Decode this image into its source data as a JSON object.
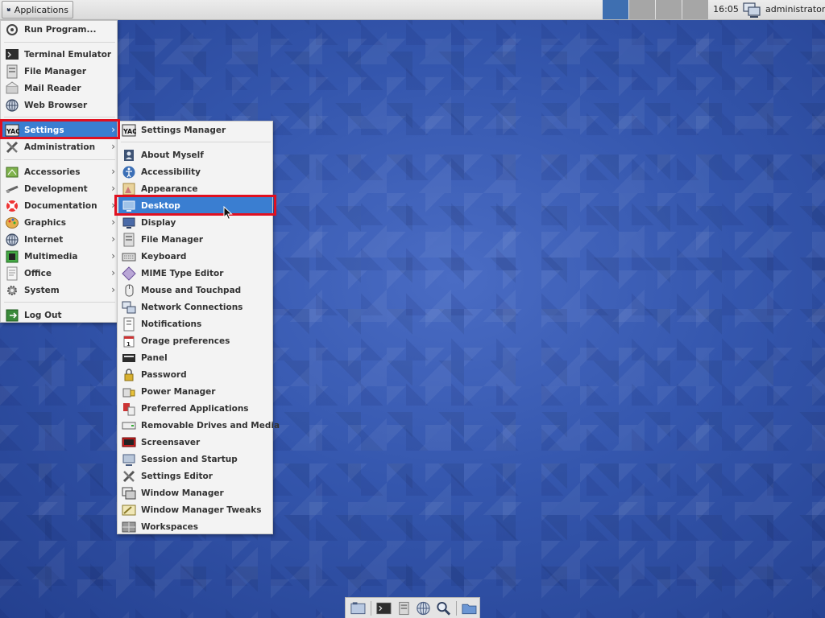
{
  "panel": {
    "applications_label": "Applications",
    "clock": "16:05",
    "user": "administrator",
    "workspace_count": 4,
    "active_workspace": 1
  },
  "main_menu": {
    "items": [
      {
        "label": "Run Program...",
        "icon": "run-icon",
        "submenu": false
      },
      {
        "label": "Terminal Emulator",
        "icon": "terminal-icon",
        "submenu": false
      },
      {
        "label": "File Manager",
        "icon": "file-manager-icon",
        "submenu": false
      },
      {
        "label": "Mail Reader",
        "icon": "mail-icon",
        "submenu": false
      },
      {
        "label": "Web Browser",
        "icon": "globe-icon",
        "submenu": false
      },
      {
        "label": "Settings",
        "icon": "settings-icon",
        "submenu": true,
        "highlighted": true
      },
      {
        "label": "Administration",
        "icon": "tools-icon",
        "submenu": true
      },
      {
        "label": "Accessories",
        "icon": "accessories-icon",
        "submenu": true
      },
      {
        "label": "Development",
        "icon": "development-icon",
        "submenu": true
      },
      {
        "label": "Documentation",
        "icon": "lifebuoy-icon",
        "submenu": true
      },
      {
        "label": "Graphics",
        "icon": "palette-icon",
        "submenu": true
      },
      {
        "label": "Internet",
        "icon": "globe-icon",
        "submenu": true
      },
      {
        "label": "Multimedia",
        "icon": "multimedia-icon",
        "submenu": true
      },
      {
        "label": "Office",
        "icon": "office-icon",
        "submenu": true
      },
      {
        "label": "System",
        "icon": "gear-icon",
        "submenu": true
      },
      {
        "label": "Log Out",
        "icon": "logout-icon",
        "submenu": false
      }
    ]
  },
  "settings_menu": {
    "items": [
      {
        "label": "Settings Manager",
        "icon": "settings-manager-icon"
      },
      {
        "label": "About Myself",
        "icon": "about-myself-icon"
      },
      {
        "label": "Accessibility",
        "icon": "accessibility-icon"
      },
      {
        "label": "Appearance",
        "icon": "appearance-icon"
      },
      {
        "label": "Desktop",
        "icon": "desktop-icon",
        "highlighted": true
      },
      {
        "label": "Display",
        "icon": "display-icon"
      },
      {
        "label": "File Manager",
        "icon": "file-manager-icon"
      },
      {
        "label": "Keyboard",
        "icon": "keyboard-icon"
      },
      {
        "label": "MIME Type Editor",
        "icon": "mime-icon"
      },
      {
        "label": "Mouse and Touchpad",
        "icon": "mouse-icon"
      },
      {
        "label": "Network Connections",
        "icon": "network-icon"
      },
      {
        "label": "Notifications",
        "icon": "notifications-icon"
      },
      {
        "label": "Orage preferences",
        "icon": "calendar-icon"
      },
      {
        "label": "Panel",
        "icon": "panel-icon"
      },
      {
        "label": "Password",
        "icon": "lock-icon"
      },
      {
        "label": "Power Manager",
        "icon": "battery-icon"
      },
      {
        "label": "Preferred Applications",
        "icon": "preferred-apps-icon"
      },
      {
        "label": "Removable Drives and Media",
        "icon": "drive-icon"
      },
      {
        "label": "Screensaver",
        "icon": "screensaver-icon"
      },
      {
        "label": "Session and Startup",
        "icon": "session-icon"
      },
      {
        "label": "Settings Editor",
        "icon": "settings-editor-icon"
      },
      {
        "label": "Window Manager",
        "icon": "window-manager-icon"
      },
      {
        "label": "Window Manager Tweaks",
        "icon": "wm-tweaks-icon"
      },
      {
        "label": "Workspaces",
        "icon": "workspaces-icon"
      }
    ]
  },
  "dock": {
    "items": [
      "show-desktop-icon",
      "terminal-icon",
      "file-manager-icon",
      "web-browser-icon",
      "search-icon",
      "folder-icon"
    ]
  }
}
